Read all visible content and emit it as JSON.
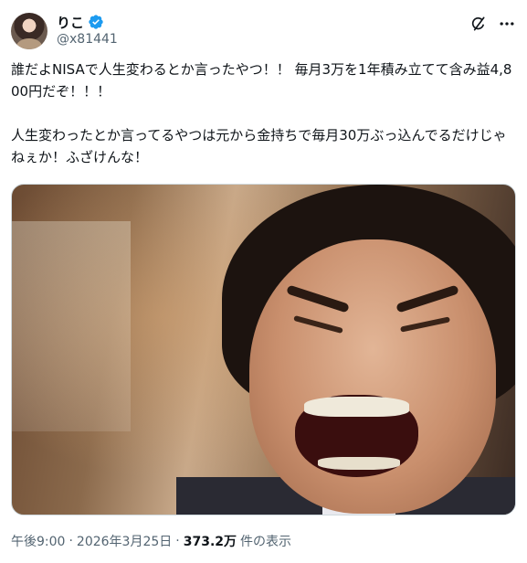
{
  "user": {
    "display_name": "りこ",
    "handle": "@x81441",
    "verified": true
  },
  "colors": {
    "verified_blue": "#1d9bf0",
    "text_primary": "#0f1419",
    "text_secondary": "#536471"
  },
  "icons": {
    "verified": "verified-badge-icon",
    "grok": "grok-icon",
    "more": "more-options-icon"
  },
  "tweet": {
    "text": "誰だよNISAで人生変わるとか言ったやつ！！ 毎月3万を1年積み立てて含み益4,800円だぞ！！！\n\n人生変わったとか言ってるやつは元から金持ちで毎月30万ぶっ込んでるだけじゃねぇか！ふざけんな！"
  },
  "meta": {
    "time": "午後9:00",
    "separator1": "·",
    "date": "2026年3月25日",
    "separator2": "·",
    "views_count": "373.2万",
    "views_label": "件の表示"
  }
}
